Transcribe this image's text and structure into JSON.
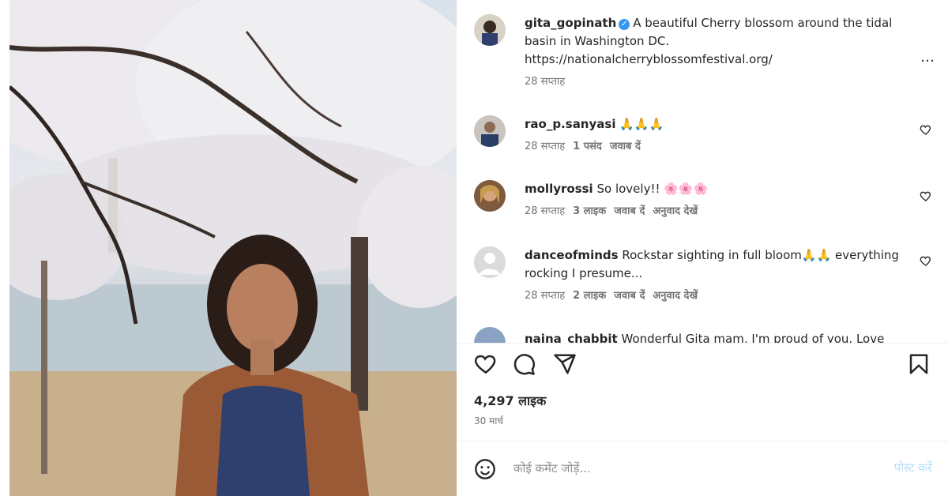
{
  "post": {
    "author": "gita_gopinath",
    "caption": "A beautiful Cherry blossom around the tidal basin in Washington DC.",
    "caption_link": "https://nationalcherryblossomfestival.org/",
    "caption_time": "28 सप्ताह",
    "more_icon": "…"
  },
  "comments": [
    {
      "username": "rao_p.sanyasi",
      "text": "🙏🙏🙏",
      "time": "28 सप्ताह",
      "likes": "1 पसंद",
      "reply": "जवाब दें",
      "translate": ""
    },
    {
      "username": "mollyrossi",
      "text": "So lovely!! 🌸🌸🌸",
      "time": "28 सप्ताह",
      "likes": "3 लाइक",
      "reply": "जवाब दें",
      "translate": "अनुवाद देखें"
    },
    {
      "username": "danceofminds",
      "text": "Rockstar sighting in full bloom🙏🙏 everything rocking I presume...",
      "time": "28 सप्ताह",
      "likes": "2 लाइक",
      "reply": "जवाब दें",
      "translate": "अनुवाद देखें"
    },
    {
      "username": "naina_chabbit",
      "text": "Wonderful Gita mam, I'm proud of you. Love"
    }
  ],
  "footer": {
    "likes_count": "4,297 लाइक",
    "post_date": "30 मार्च",
    "comment_placeholder": "कोई कमेंट जोड़ें...",
    "post_button": "पोस्ट करें"
  },
  "colors": {
    "verified": "#3897f0",
    "post_button": "#b2dffc"
  }
}
